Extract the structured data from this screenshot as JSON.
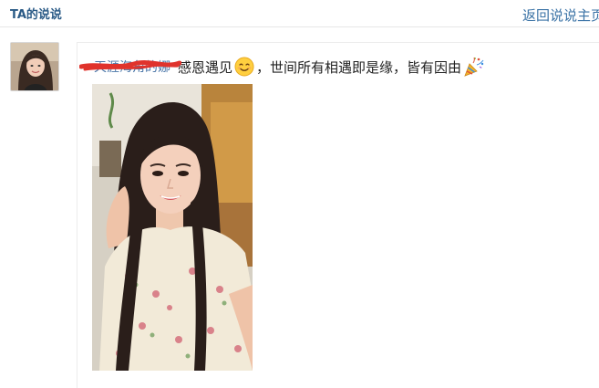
{
  "header": {
    "title": "TA的说说",
    "back_label": "返回说说主页"
  },
  "post": {
    "author": "天涯海角的娜",
    "text_before_emoji": "感恩遇见",
    "text_after_emoji": "，世间所有相遇即是缘，皆有因由",
    "emojis": [
      "smile-emoji",
      "party-popper-emoji"
    ]
  },
  "colors": {
    "title": "#2a5a86",
    "link": "#3b73a6",
    "author": "#4a76a8",
    "redaction": "#e0332c"
  }
}
